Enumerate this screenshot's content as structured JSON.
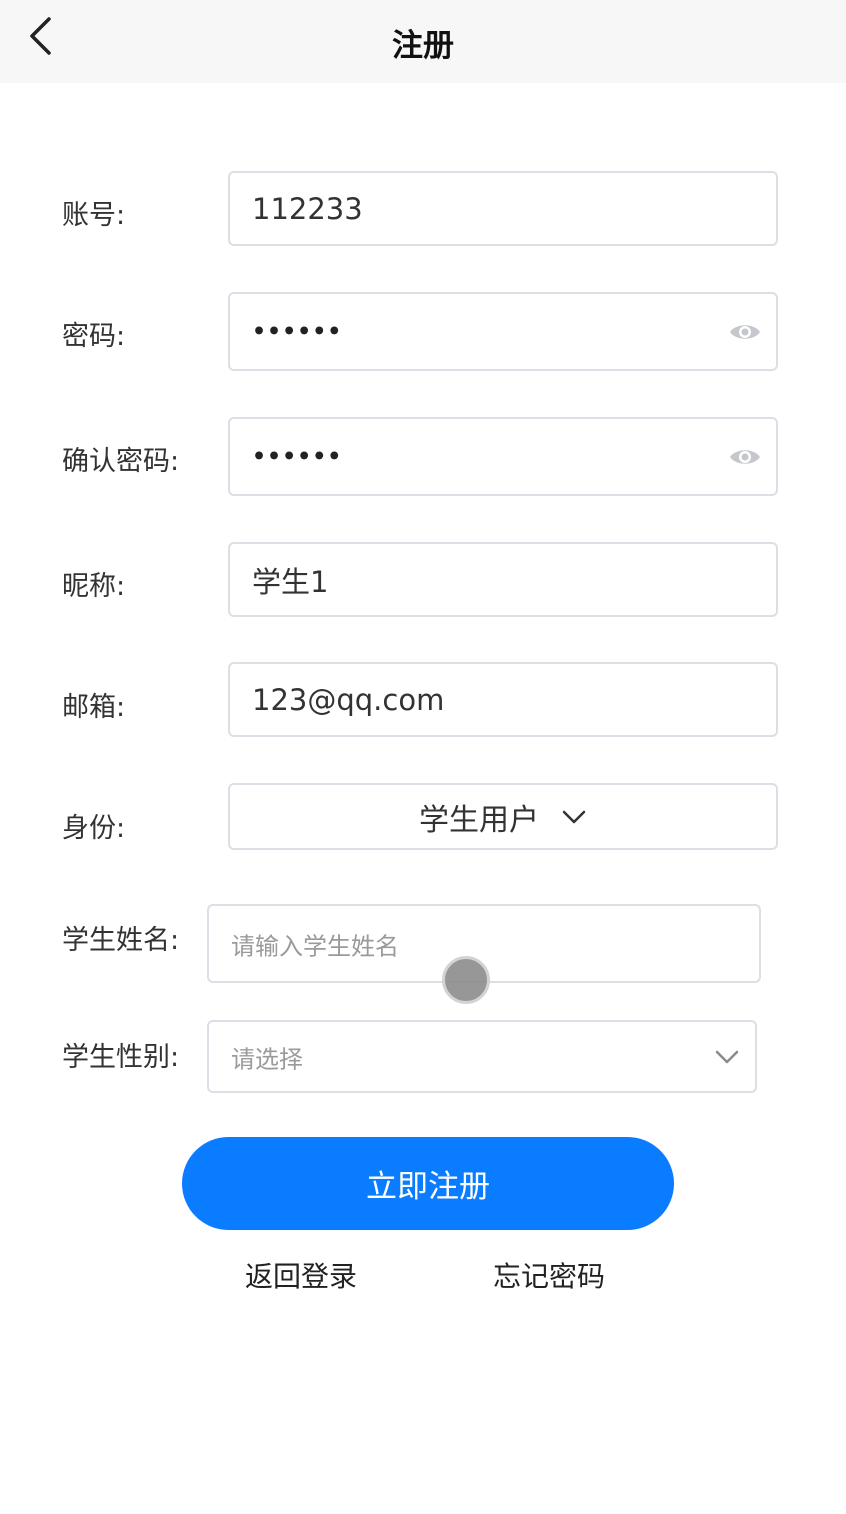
{
  "header": {
    "title": "注册"
  },
  "form": {
    "account": {
      "label": "账号:",
      "value": "112233"
    },
    "password": {
      "label": "密码:",
      "value": "••••••"
    },
    "confirm_password": {
      "label": "确认密码:",
      "value": "••••••"
    },
    "nickname": {
      "label": "昵称:",
      "value": "学生1"
    },
    "email": {
      "label": "邮箱:",
      "value": "123@qq.com"
    },
    "identity": {
      "label": "身份:",
      "value": "学生用户"
    },
    "student_name": {
      "label": "学生姓名:",
      "placeholder": "请输入学生姓名"
    },
    "student_gender": {
      "label": "学生性别:",
      "placeholder": "请选择"
    }
  },
  "actions": {
    "submit": "立即注册",
    "back_to_login": "返回登录",
    "forgot_password": "忘记密码"
  },
  "colors": {
    "accent": "#0a7cff",
    "border": "#dcdfe6",
    "nav_bg": "#f7f7f7"
  },
  "icons": {
    "back": "chevron-left-icon",
    "visibility": "eye-icon",
    "dropdown": "chevron-down-icon"
  }
}
